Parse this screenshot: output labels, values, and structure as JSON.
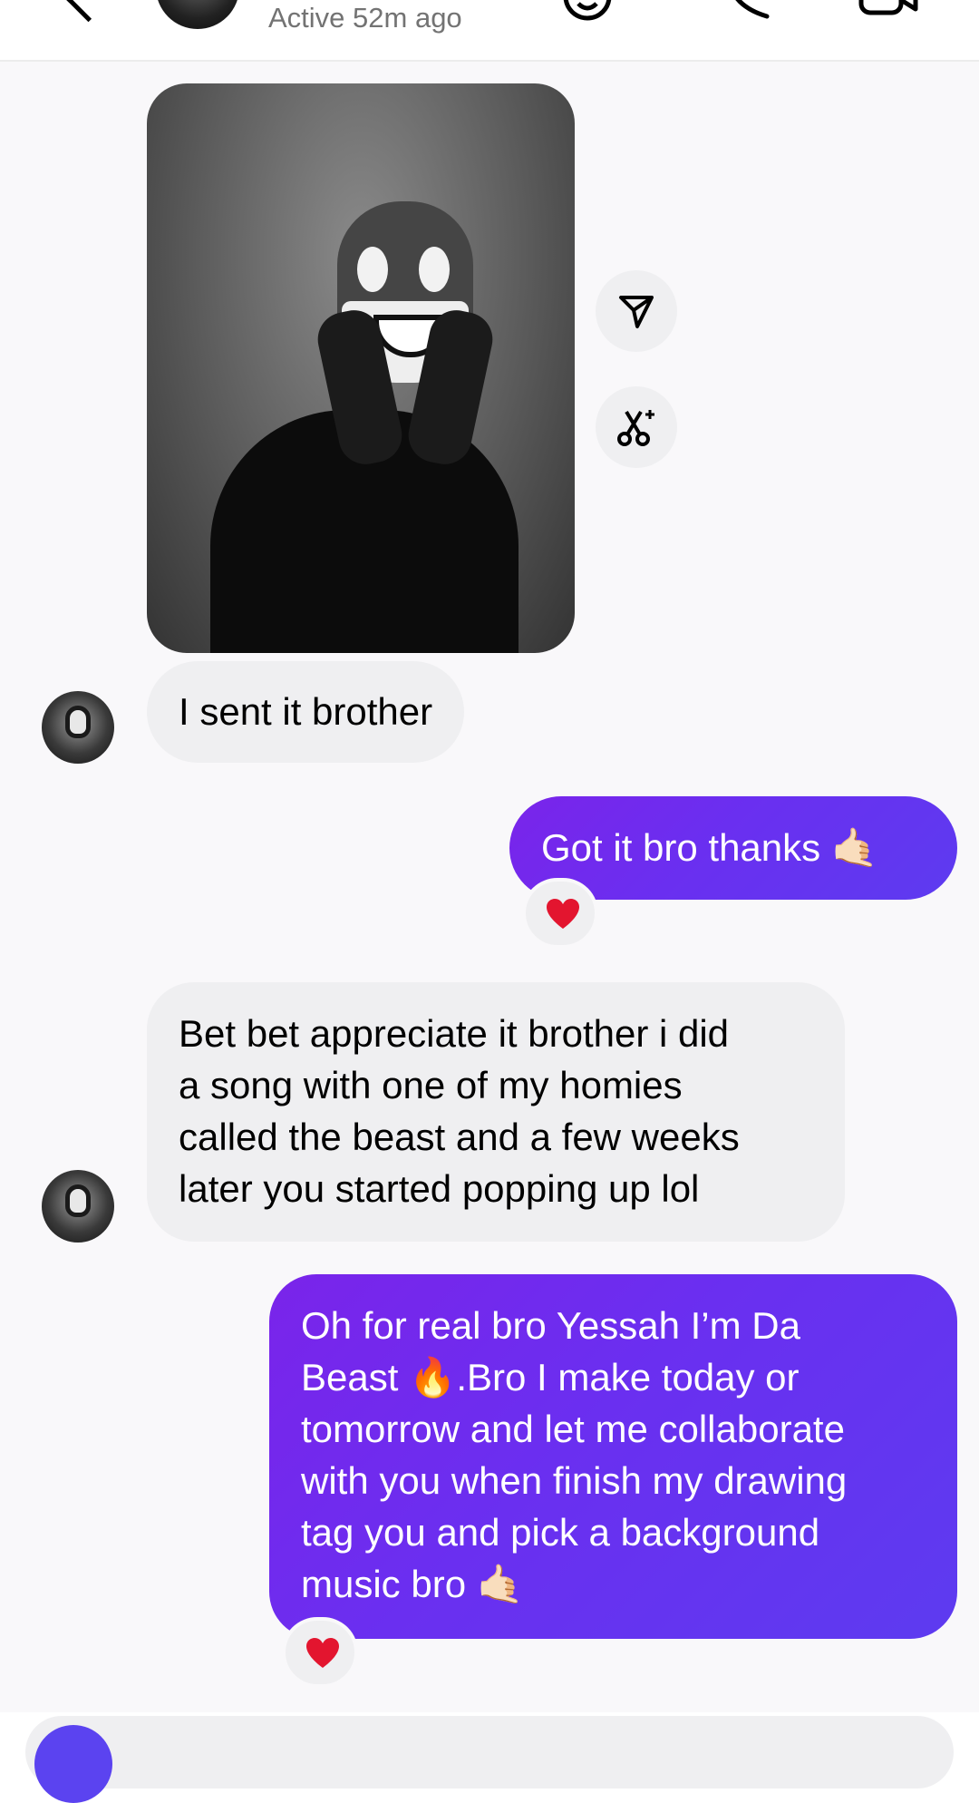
{
  "header": {
    "status": "Active 52m ago",
    "icons": [
      "back-chevron-icon",
      "sticker-icon",
      "phone-icon",
      "video-call-icon"
    ]
  },
  "photo_actions": {
    "icons": [
      "send-arrow-icon",
      "remix-scissors-icon"
    ]
  },
  "messages": [
    {
      "sender": "them",
      "type": "photo"
    },
    {
      "sender": "them",
      "text": "I sent it brother"
    },
    {
      "sender": "me",
      "text": "Got it bro thanks 🤙🏻",
      "reaction": "❤️"
    },
    {
      "sender": "them",
      "lines": [
        "Bet bet appreciate it brother i did",
        "a song with one of my homies",
        "called the beast and a few weeks",
        "later you started popping up lol"
      ]
    },
    {
      "sender": "me",
      "lines": [
        "Oh for real bro Yessah I’m Da",
        "Beast 🔥.Bro I make today or",
        "tomorrow and let me collaborate",
        "with you when finish my drawing",
        "tag you and pick a background",
        "music bro 🤙🏻"
      ],
      "reaction": "❤️"
    }
  ],
  "colors": {
    "outgoing_gradient_start": "#7a24ea",
    "outgoing_gradient_end": "#5d3bf0",
    "incoming_bubble": "#efeff1",
    "background": "#f9f8fa",
    "status_text": "#737373"
  }
}
